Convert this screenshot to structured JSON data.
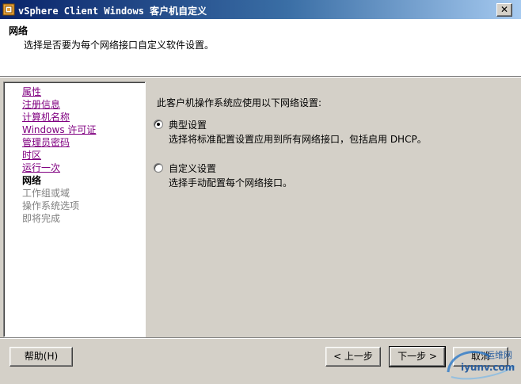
{
  "window": {
    "title": "vSphere Client Windows 客户机自定义",
    "close_glyph": "✕"
  },
  "header": {
    "title": "网络",
    "description": "选择是否要为每个网络接口自定义软件设置。"
  },
  "nav": {
    "items": [
      {
        "label": "属性",
        "state": "visited"
      },
      {
        "label": "注册信息",
        "state": "visited"
      },
      {
        "label": "计算机名称",
        "state": "visited"
      },
      {
        "label": "Windows 许可证",
        "state": "visited"
      },
      {
        "label": "管理员密码",
        "state": "visited"
      },
      {
        "label": "时区",
        "state": "visited"
      },
      {
        "label": "运行一次",
        "state": "visited"
      },
      {
        "label": "网络",
        "state": "current"
      },
      {
        "label": "工作组或域",
        "state": "disabled"
      },
      {
        "label": "操作系统选项",
        "state": "disabled"
      },
      {
        "label": "即将完成",
        "state": "disabled"
      }
    ]
  },
  "content": {
    "prompt": "此客户机操作系统应使用以下网络设置:",
    "options": [
      {
        "label": "典型设置",
        "description": "选择将标准配置设置应用到所有网络接口，包括启用 DHCP。",
        "selected": true
      },
      {
        "label": "自定义设置",
        "description": "选择手动配置每个网络接口。",
        "selected": false
      }
    ]
  },
  "buttons": {
    "help": "帮助(H)",
    "back": "< 上一步",
    "next": "下一步 >",
    "cancel": "取消"
  },
  "watermark": {
    "text": "iyunv.com",
    "cn": "运维网"
  },
  "colors": {
    "titlebar_start": "#0a246a",
    "titlebar_end": "#a6caf0",
    "visited_link": "#800080",
    "disabled_text": "#808080"
  }
}
